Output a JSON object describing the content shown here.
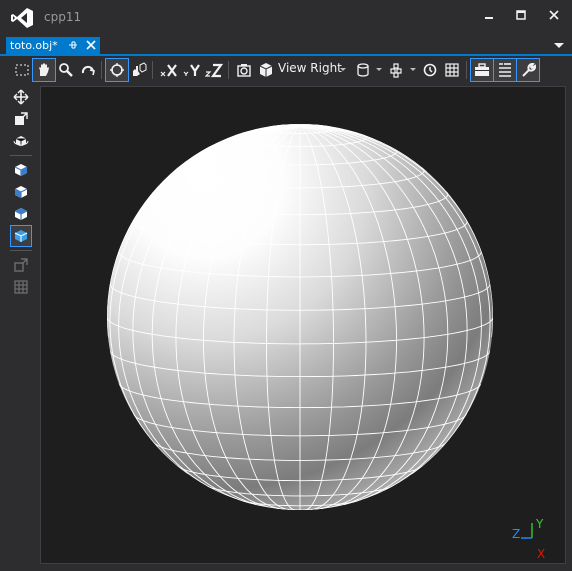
{
  "app": {
    "title": "cpp11"
  },
  "tabs": [
    {
      "label": "toto.obj*",
      "active": true
    }
  ],
  "toolbar": {
    "view_label": "View Right",
    "items": [
      "select-tool",
      "pan-tool",
      "zoom-tool",
      "orbit-tool",
      "zoom-fit",
      "frame-selection",
      "flip-x",
      "flip-y",
      "flip-z",
      "camera",
      "view-cube",
      "view-right",
      "shading-mode",
      "render-mode",
      "reset-view",
      "grid",
      "toolbox",
      "properties",
      "settings"
    ]
  },
  "left_tools": [
    "move-tool",
    "scale-tool",
    "rotate-tool",
    "cube-a",
    "cube-b",
    "cube-c",
    "cube-d",
    "object-mode",
    "grid-mode"
  ],
  "axis_labels": {
    "x": "X",
    "y": "Y",
    "z": "Z"
  },
  "colors": {
    "accent": "#007acc",
    "axis_x": "#e51400",
    "axis_y": "#33cc33",
    "axis_z": "#1e90ff",
    "background": "#2d2d30",
    "viewport": "#1e1e1e"
  }
}
